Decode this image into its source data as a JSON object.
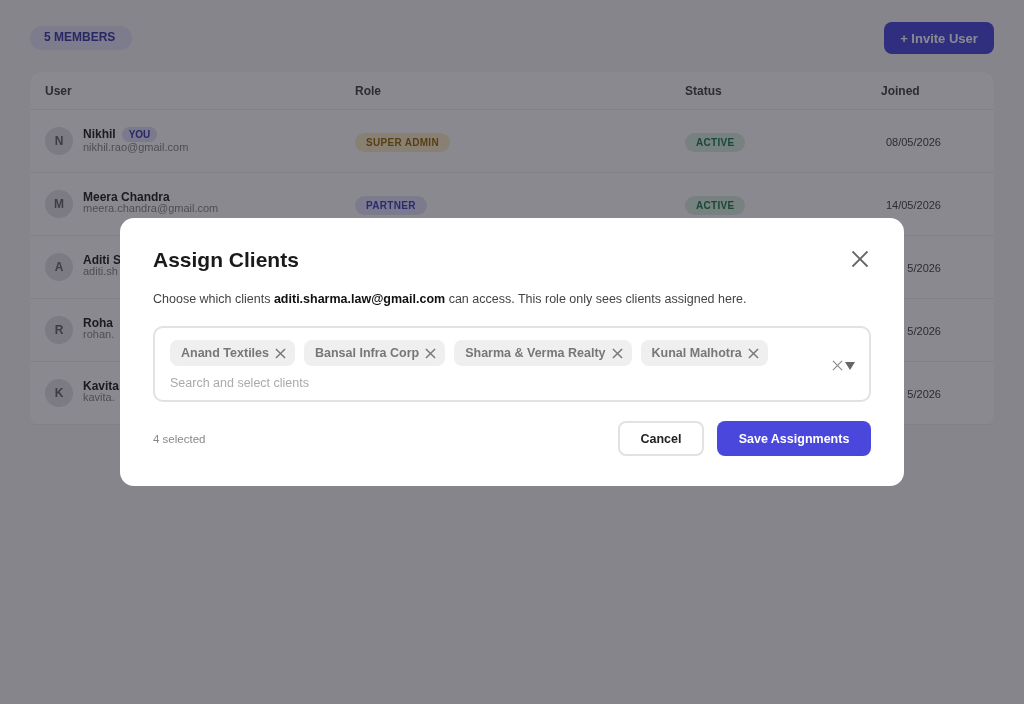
{
  "members_badge": "5 MEMBERS",
  "invite_button": "+ Invite User",
  "table": {
    "columns": [
      "User",
      "Role",
      "Status",
      "Joined"
    ],
    "rows": [
      {
        "avatar": "N",
        "name": "Nikhil",
        "you_badge": "YOU",
        "email": "nikhil.rao@gmail.com",
        "role": {
          "label": "SUPER ADMIN",
          "kind": "admin"
        },
        "status": {
          "label": "ACTIVE",
          "kind": "active"
        },
        "joined": "08/05/2026"
      },
      {
        "avatar": "M",
        "name": "Meera Chandra",
        "email": "meera.chandra@gmail.com",
        "role": {
          "label": "PARTNER",
          "kind": "partner"
        },
        "status": {
          "label": "ACTIVE",
          "kind": "active"
        },
        "joined": "14/05/2026"
      },
      {
        "avatar": "A",
        "name": "Aditi S",
        "email": "aditi.sh",
        "joined": "5/2026"
      },
      {
        "avatar": "R",
        "name": "Roha",
        "email": "rohan.",
        "joined": "5/2026"
      },
      {
        "avatar": "K",
        "name": "Kavita",
        "email": "kavita.",
        "joined": "5/2026"
      }
    ]
  },
  "modal": {
    "title": "Assign Clients",
    "description": "Choose which clients **aditi.sharma.law@gmail.com** can access. This role only sees clients assigned here.",
    "chips": [
      "Anand Textiles",
      "Bansal Infra Corp",
      "Sharma & Verma Realty",
      "Kunal Malhotra"
    ],
    "placeholder": "Search and select clients",
    "count": "4 selected",
    "cancel": "Cancel",
    "save": "Save Assignments"
  }
}
